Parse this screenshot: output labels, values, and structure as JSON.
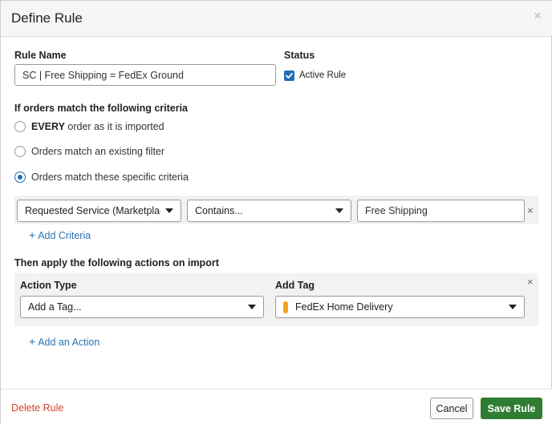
{
  "dialog": {
    "title": "Define Rule",
    "close_glyph": "×"
  },
  "rule_name": {
    "label": "Rule Name",
    "value": "SC | Free Shipping = FedEx Ground"
  },
  "status": {
    "label": "Status",
    "checkbox_label": "Active Rule",
    "checked": true
  },
  "criteria": {
    "heading": "If orders match the following criteria",
    "options": [
      {
        "bold": "EVERY",
        "text": " order as it is imported",
        "selected": false
      },
      {
        "bold": "",
        "text": "Orders match an existing filter",
        "selected": false
      },
      {
        "bold": "",
        "text": "Orders match these specific criteria",
        "selected": true
      }
    ],
    "row": {
      "field": "Requested Service (Marketplac...",
      "operator": "Contains...",
      "value": "Free Shipping",
      "remove_glyph": "×"
    },
    "add_link": "Add Criteria"
  },
  "actions": {
    "heading": "Then apply the following actions on import",
    "action_type_label": "Action Type",
    "add_tag_label": "Add Tag",
    "action_type_value": "Add a Tag...",
    "tag_value": "FedEx Home Delivery",
    "tag_color": "#f5a11b",
    "remove_glyph": "×",
    "add_link": "Add an Action"
  },
  "footer": {
    "delete_label": "Delete Rule",
    "cancel_label": "Cancel",
    "save_label": "Save Rule"
  },
  "icons": {
    "plus": "+",
    "caret": "chevron-down-icon",
    "check": "checkmark-icon"
  },
  "colors": {
    "accent": "#1f6fb5",
    "link": "#2a73b6",
    "danger": "#d6422b",
    "primary": "#2f7d32"
  }
}
